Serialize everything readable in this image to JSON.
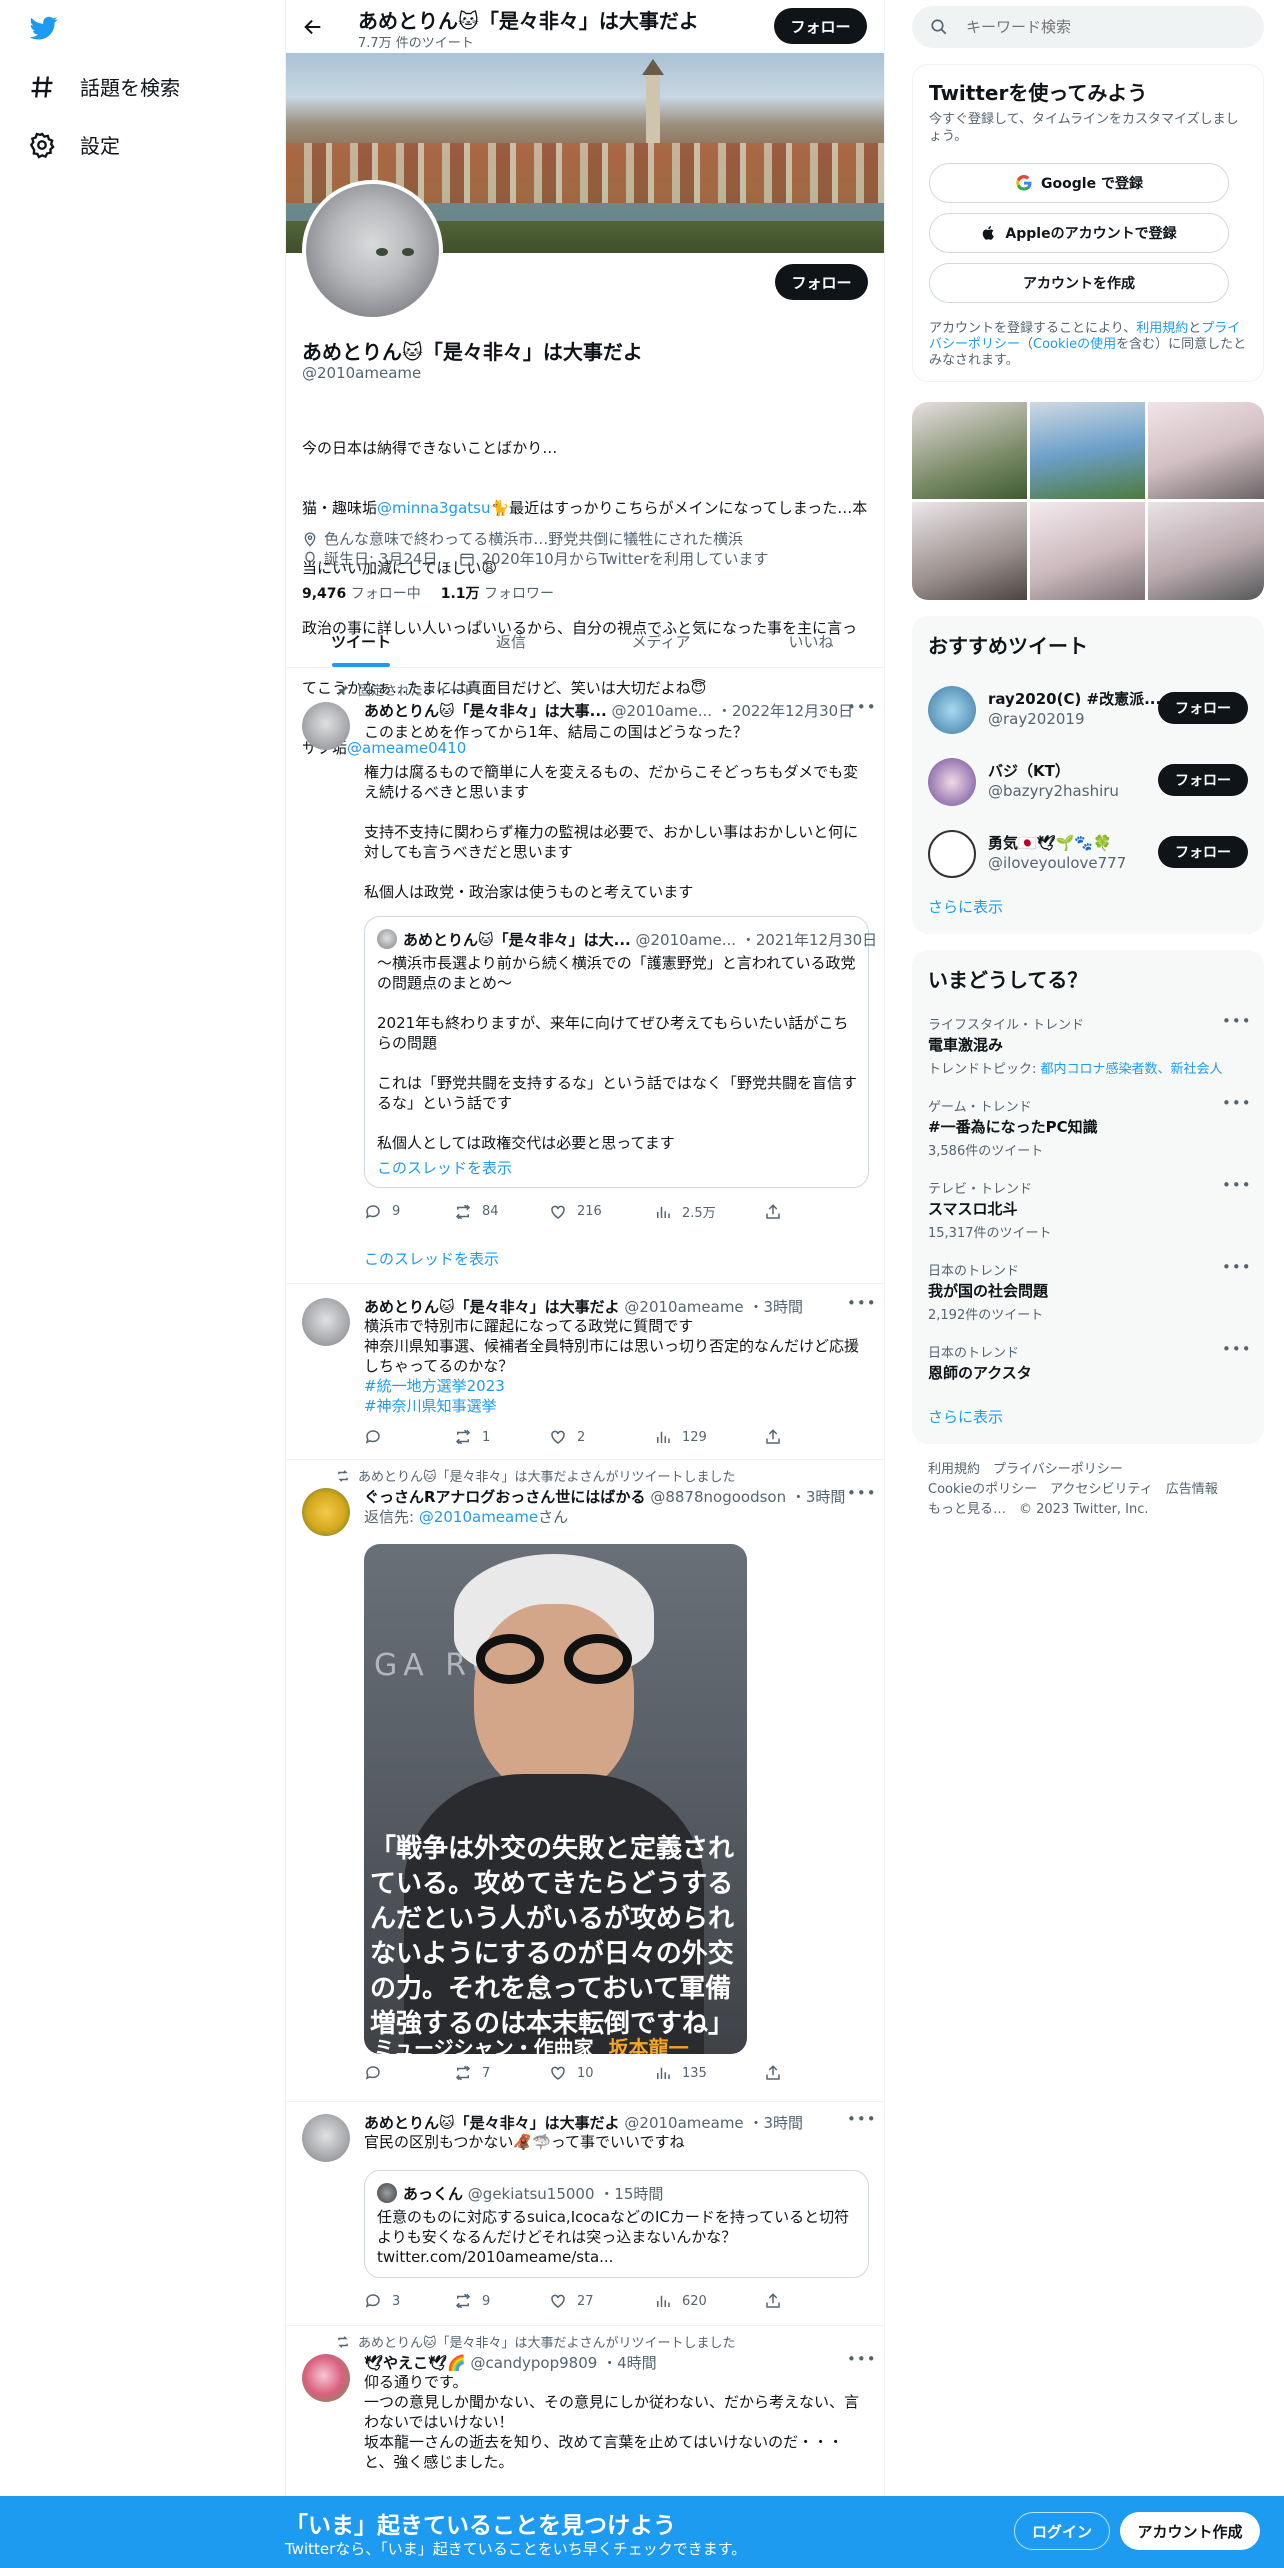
{
  "nav": {
    "explore_label": "話題を検索",
    "settings_label": "設定"
  },
  "header": {
    "title": "あめとりん🐱「是々非々」は大事だよ",
    "subtitle": "7.7万 件のツイート",
    "follow_label": "フォロー"
  },
  "profile": {
    "name": "あめとりん🐱「是々非々」は大事だよ",
    "handle": "@2010ameame",
    "follow_label": "フォロー",
    "bio_line1": "今の日本は納得できないことばかり…",
    "bio_line2_pre": "猫・趣味垢",
    "bio_line2_link": "@minna3gatsu",
    "bio_line2_post": "🐈最近はすっかりこちらがメインになってしまった…本",
    "bio_line3": "当にいい加減にしてほしい😩",
    "bio_line4": "政治の事に詳しい人いっぱいいるから、自分の視点でふと気になった事を主に言っ",
    "bio_line5": "てこうかなぁ…たまには真面目だけど、笑いは大切だよね😇",
    "bio_line6_pre": "サブ垢",
    "bio_line6_link": "@ameame0410",
    "location": "色んな意味で終わってる横浜市…野党共倒に犠牲にされた横浜",
    "birthday": "誕生日: 3月24日",
    "joined": "2020年10月からTwitterを利用しています",
    "following_count": "9,476",
    "following_label": "フォロー中",
    "followers_count": "1.1万",
    "followers_label": "フォロワー"
  },
  "tabs": [
    "ツイート",
    "返信",
    "メディア",
    "いいね"
  ],
  "tweets": {
    "t1": {
      "pinned_label": "固定されたツイート",
      "name": "あめとりん🐱「是々非々」は大事...",
      "handle": "@2010ame...",
      "date": "・2022年12月30日",
      "text": "このまとめを作ってから1年、結局この国はどうなった？\n\n権力は腐るもので簡単に人を変えるもの、だからこそどっちもダメでも変え続けるべきと思います\n\n支持不支持に関わらず権力の監視は必要で、おかしい事はおかしいと何に対しても言うべきだと思います\n\n私個人は政党・政治家は使うものと考えています",
      "quote_name": "あめとりん🐱「是々非々」は大...",
      "quote_handle": "@2010ame...",
      "quote_date": "・2021年12月30日",
      "quote_text": "〜横浜市長選より前から続く横浜での「護憲野党」と言われている政党の問題点のまとめ〜\n\n2021年も終わりますが、来年に向けてぜひ考えてもらいたい話がこちらの問題\n\nこれは「野党共闘を支持するな」という話ではなく「野党共闘を盲信するな」という話です\n\n私個人としては政権交代は必要と思ってます",
      "quote_thread": "このスレッドを表示",
      "replies": "9",
      "retweets": "84",
      "likes": "216",
      "views": "2.5万",
      "thread_link": "このスレッドを表示"
    },
    "t2": {
      "name": "あめとりん🐱「是々非々」は大事だよ",
      "handle": "@2010ameame",
      "date": "・3時間",
      "text": "横浜市で特別市に躍起になってる政党に質問です\n神奈川県知事選、候補者全員特別市には思いっ切り否定的なんだけど応援しちゃってるのかな？",
      "hashtag1": "#統一地方選挙2023",
      "hashtag2": "#神奈川県知事選挙",
      "replies": "",
      "retweets": "1",
      "likes": "2",
      "views": "129"
    },
    "t3": {
      "retweeted_by": "あめとりん🐱「是々非々」は大事だよさんがリツイートしました",
      "name": "ぐっさんRアナログおっさん世にはばかる",
      "handle": "@8878nogoodson",
      "date": "・3時間",
      "reply_to_pre": "返信先: ",
      "reply_to_link": "@2010ameame",
      "reply_to_post": "さん",
      "image_quote": "「戦争は外交の失敗と定義されている。攻めてきたらどうするんだという人がいるが攻められないようにするのが日々の外交の力。それを怠っておいて軍備増強するのは本末転倒ですね」",
      "image_caption_role": "ミュージシャン・作曲家",
      "image_caption_name": "坂本龍一",
      "image_bg_text": "GA  ROR  ARD",
      "replies": "",
      "retweets": "7",
      "likes": "10",
      "views": "135"
    },
    "t4": {
      "name": "あめとりん🐱「是々非々」は大事だよ",
      "handle": "@2010ameame",
      "date": "・3時間",
      "text": "官民の区別もつかない🦧🦈って事でいいですね",
      "quote_name": "あっくん",
      "quote_handle": "@gekiatsu15000",
      "quote_date": "・15時間",
      "quote_text": "任意のものに対応するsuica,IcocaなどのICカードを持っていると切符よりも安くなるんだけどそれは突っ込まないんかな？\ntwitter.com/2010ameame/sta...",
      "replies": "3",
      "retweets": "9",
      "likes": "27",
      "views": "620"
    },
    "t5": {
      "retweeted_by": "あめとりん🐱「是々非々」は大事だよさんがリツイートしました",
      "name": "🕊やえこ🕊🌈",
      "handle": "@candypop9809",
      "date": "・4時間",
      "text": "仰る通りです。\n一つの意見しか聞かない、その意見にしか従わない、だから考えない、言わないではいけない！\n坂本龍一さんの逝去を知り、改めて言葉を止めてはいけないのだ・・・と、強く感じました。"
    }
  },
  "right": {
    "search_placeholder": "キーワード検索",
    "signup_title": "Twitterを使ってみよう",
    "signup_sub": "今すぐ登録して、タイムラインをカスタマイズしましょう。",
    "google_label": "Google で登録",
    "apple_label": "Appleのアカウントで登録",
    "create_label": "アカウントを作成",
    "terms_pre": "アカウントを登録することにより、",
    "terms_link1": "利用規約",
    "terms_and": "と",
    "terms_link2": "プライバシーポリシー",
    "terms_link3": "Cookieの使用",
    "terms_post": "を含む）に同意したとみなされます。",
    "rec_title": "おすすめツイート",
    "rec_users": [
      {
        "name": "ray2020(C) #改憲派...",
        "handle": "@ray202019",
        "follow": "フォロー"
      },
      {
        "name": "バジ（KT）",
        "handle": "@bazyry2hashiru",
        "follow": "フォロー"
      },
      {
        "name": "勇気🇯🇵🕊🌱🐾🍀",
        "handle": "@iloveyoulove777",
        "follow": "フォロー"
      }
    ],
    "rec_more": "さらに表示",
    "trends_title": "いまどうしてる？",
    "trends": [
      {
        "category": "ライフスタイル・トレンド",
        "name": "電車激混み",
        "meta_pre": "トレンドトピック: ",
        "meta_link": "都内コロナ感染者数、新社会人"
      },
      {
        "category": "ゲーム・トレンド",
        "name": "#一番為になったPC知識",
        "meta": "3,586件のツイート"
      },
      {
        "category": "テレビ・トレンド",
        "name": "スマスロ北斗",
        "meta": "15,317件のツイート"
      },
      {
        "category": "日本のトレンド",
        "name": "我が国の社会問題",
        "meta": "2,192件のツイート"
      },
      {
        "category": "日本のトレンド",
        "name": "恩師のアクスタ",
        "meta": ""
      }
    ],
    "trends_more": "さらに表示",
    "footer_line1": "利用規約　プライバシーポリシー",
    "footer_line2": "Cookieのポリシー　アクセシビリティ　広告情報",
    "footer_line3": "もっと見る…　© 2023 Twitter, Inc."
  },
  "bottombar": {
    "title": "「いま」起きていることを見つけよう",
    "subtitle": "Twitterなら、「いま」起きていることをいち早くチェックできます。",
    "login_label": "ログイン",
    "signup_label": "アカウント作成"
  },
  "colors": {
    "accent": "#1d9bf0",
    "text": "#0f1419",
    "muted": "#536471"
  }
}
